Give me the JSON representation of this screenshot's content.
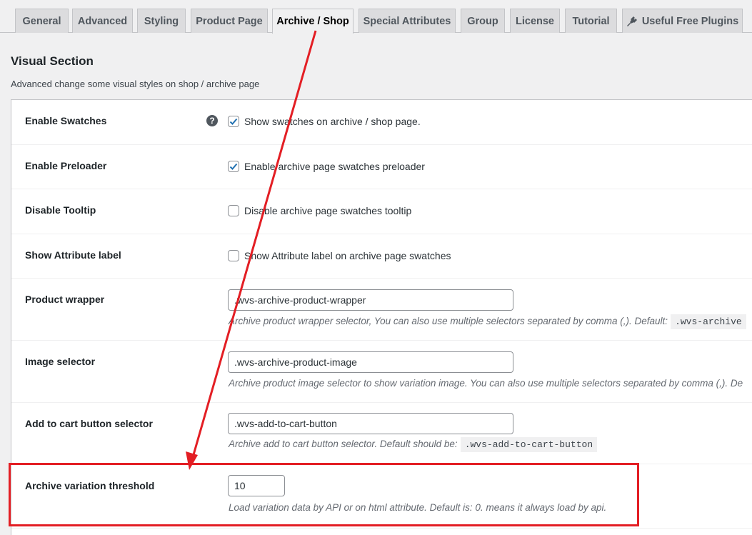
{
  "tabs": [
    {
      "label": "General"
    },
    {
      "label": "Advanced"
    },
    {
      "label": "Styling"
    },
    {
      "label": "Product Page"
    },
    {
      "label": "Archive / Shop",
      "active": true
    },
    {
      "label": "Special Attributes"
    },
    {
      "label": "Group"
    },
    {
      "label": "License"
    },
    {
      "label": "Tutorial"
    },
    {
      "label": "Useful Free Plugins",
      "icon": "plug-icon"
    }
  ],
  "section": {
    "title": "Visual Section",
    "description": "Advanced change some visual styles on shop / archive page"
  },
  "rows": {
    "enable_swatches": {
      "label": "Enable Swatches",
      "checked": true,
      "checkbox_label": "Show swatches on archive / shop page.",
      "help_icon": "?"
    },
    "enable_preloader": {
      "label": "Enable Preloader",
      "checked": true,
      "checkbox_label": "Enable archive page swatches preloader"
    },
    "disable_tooltip": {
      "label": "Disable Tooltip",
      "checked": false,
      "checkbox_label": "Disable archive page swatches tooltip"
    },
    "show_attribute_label": {
      "label": "Show Attribute label",
      "checked": false,
      "checkbox_label": "Show Attribute label on archive page swatches"
    },
    "product_wrapper": {
      "label": "Product wrapper",
      "value": ".wvs-archive-product-wrapper",
      "description": "Archive product wrapper selector, You can also use multiple selectors separated by comma (,). Default:",
      "default_code": ".wvs-archive"
    },
    "image_selector": {
      "label": "Image selector",
      "value": ".wvs-archive-product-image",
      "description": "Archive product image selector to show variation image. You can also use multiple selectors separated by comma (,). De"
    },
    "add_to_cart_selector": {
      "label": "Add to cart button selector",
      "value": ".wvs-add-to-cart-button",
      "description": "Archive add to cart button selector. Default should be:",
      "default_code": ".wvs-add-to-cart-button"
    },
    "archive_variation_threshold": {
      "label": "Archive variation threshold",
      "value": "10",
      "description": "Load variation data by API or on html attribute. Default is: 0. means it always load by api."
    }
  },
  "colors": {
    "annotation_red": "#e31e24",
    "checkbox_blue": "#2271b1",
    "page_bg": "#f0f0f1"
  }
}
